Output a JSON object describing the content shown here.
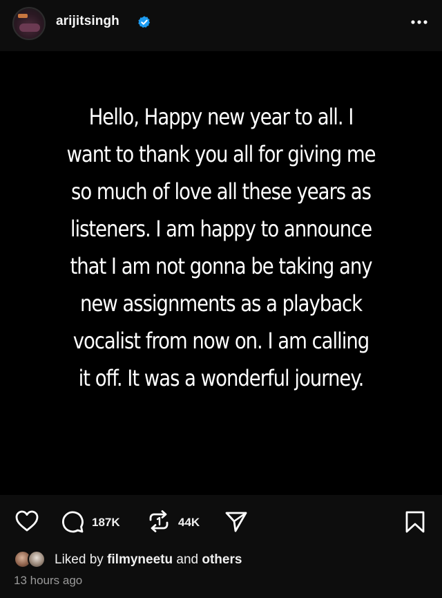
{
  "header": {
    "username": "arijitsingh",
    "verified_icon": "verified-badge-icon",
    "more_icon": "more-dots-icon"
  },
  "post": {
    "lines": [
      "Hello, Happy new year to all. I",
      "want to thank you all for giving me",
      "so much of love all these years as",
      "listeners. I am happy to announce",
      "that I am not gonna be taking any",
      "new assignments as a playback",
      "vocalist from now on. I am calling",
      "it off. It was a wonderful journey."
    ]
  },
  "actions": {
    "like_icon": "heart-icon",
    "comment_icon": "comment-icon",
    "comment_count": "187K",
    "repost_icon": "repost-icon",
    "repost_count": "44K",
    "share_icon": "send-icon",
    "save_icon": "bookmark-icon"
  },
  "likes": {
    "prefix": "Liked by",
    "user": "filmyneetu",
    "conjunction": "and",
    "others": "others"
  },
  "timestamp": "13 hours ago",
  "colors": {
    "background": "#000000",
    "bar_background": "#0d0d0d",
    "verified_blue": "#1d9bf0",
    "muted_text": "#9a9a9a"
  }
}
